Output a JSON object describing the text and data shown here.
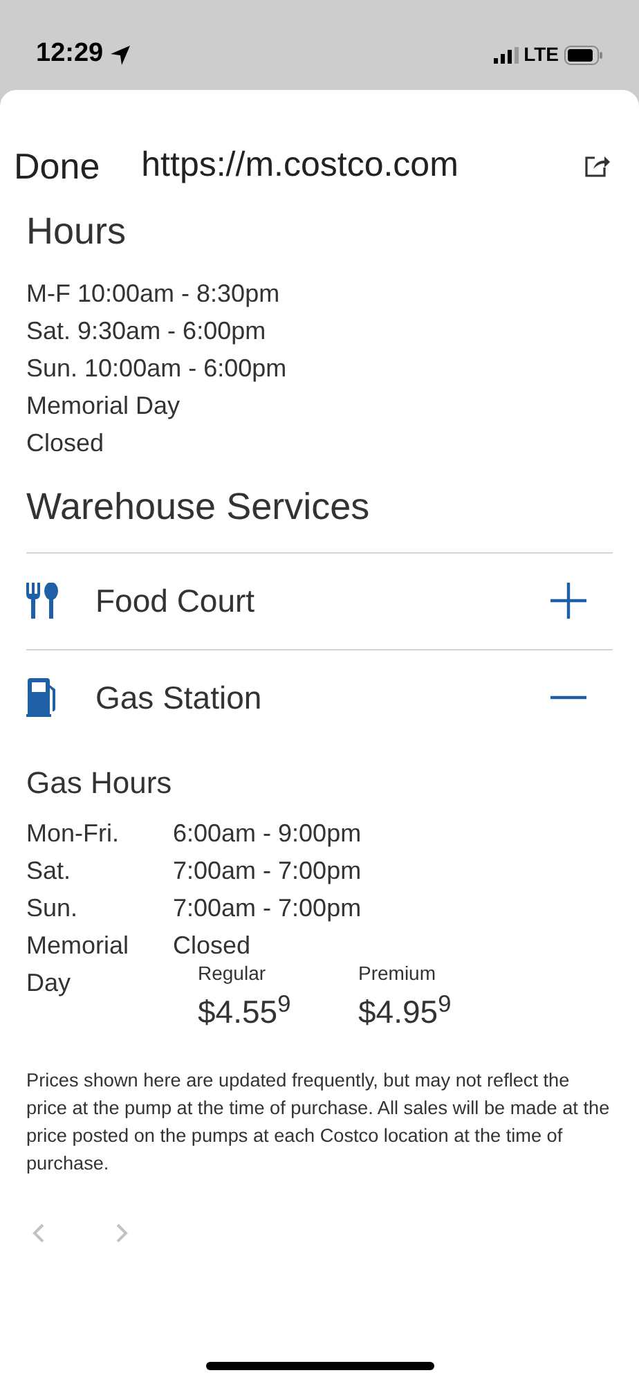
{
  "status_bar": {
    "time": "12:29",
    "network": "LTE"
  },
  "browser": {
    "done": "Done",
    "url": "https://m.costco.com"
  },
  "hours": {
    "title": "Hours",
    "lines": [
      "M-F 10:00am - 8:30pm",
      "Sat. 9:30am - 6:00pm",
      "Sun. 10:00am - 6:00pm",
      "Memorial Day",
      "Closed"
    ]
  },
  "services": {
    "title": "Warehouse Services",
    "items": [
      {
        "kind": "food",
        "label": "Food Court",
        "expanded": false
      },
      {
        "kind": "gas",
        "label": "Gas Station",
        "expanded": true
      }
    ]
  },
  "gas": {
    "title": "Gas Hours",
    "rows": [
      {
        "day": "Mon-Fri.",
        "hours": "6:00am - 9:00pm"
      },
      {
        "day": "Sat.",
        "hours": "7:00am - 7:00pm"
      },
      {
        "day": "Sun.",
        "hours": "7:00am - 7:00pm"
      },
      {
        "day": "Memorial",
        "hours": "Closed"
      }
    ],
    "last_day": "Day",
    "prices": [
      {
        "grade": "Regular",
        "price": "$4.55$^{9}$"
      },
      {
        "grade": "Premium",
        "price": "$4.95$^{9}$"
      }
    ],
    "disclaimer": "Prices shown here are updated frequently, but may not reflect the price at the pump at the time of purchase. All sales will be made at the price posted on the pumps at each Costco location at the time of purchase."
  },
  "toolbar": {
    "back_disabled": true,
    "forward_disabled": true
  }
}
